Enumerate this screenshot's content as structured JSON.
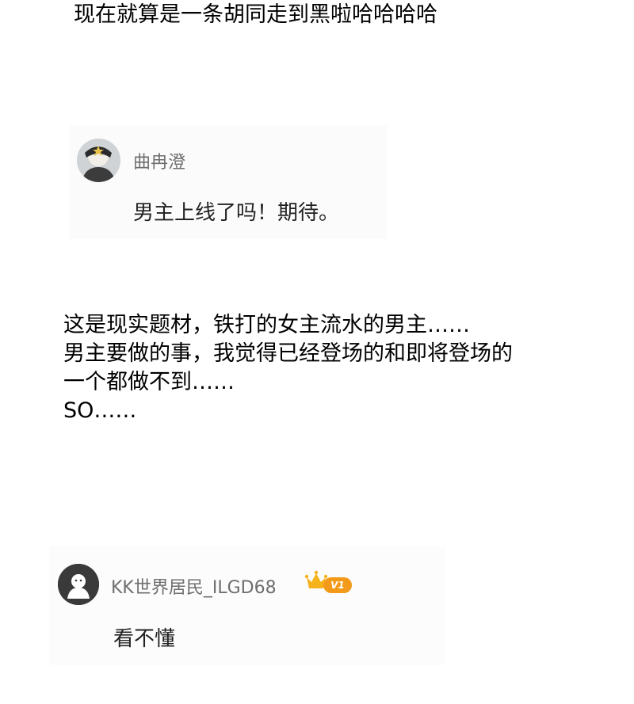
{
  "top_line": "现在就算是一条胡同走到黑啦哈哈哈哈",
  "comment1": {
    "username": "曲冉澄",
    "text": "男主上线了吗！期待。"
  },
  "body_lines": [
    "这是现实题材，铁打的女主流水的男主……",
    "男主要做的事，我觉得已经登场的和即将登场的",
    "一个都做不到……",
    "SO……"
  ],
  "comment2": {
    "username": "KK世界居民_ILGD68",
    "badge": "V1",
    "text": "看不懂"
  },
  "colors": {
    "username": "#6e6e6e",
    "badge": "#f39a1a",
    "crown": "#f6b21b"
  }
}
